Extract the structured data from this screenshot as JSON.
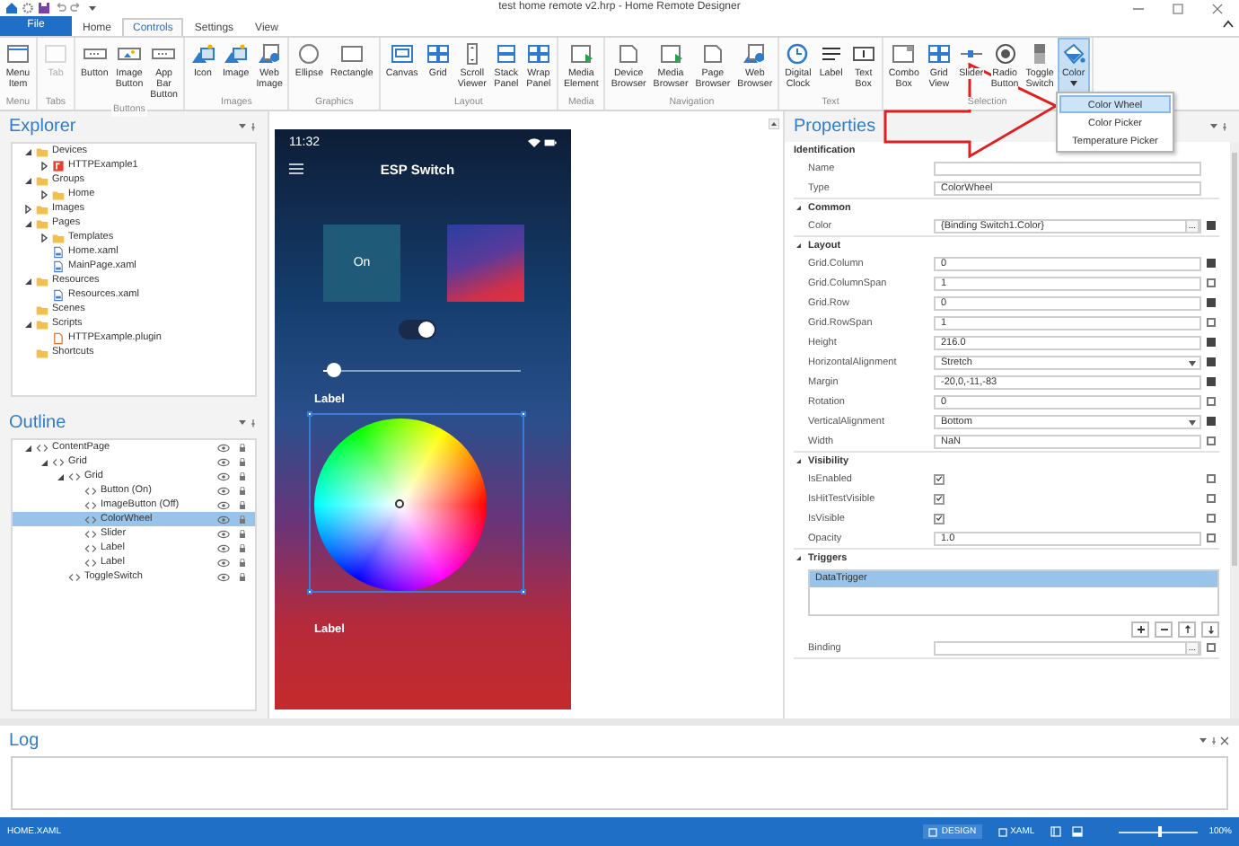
{
  "window": {
    "title": "test home remote v2.hrp - Home Remote Designer"
  },
  "menu_tabs": [
    {
      "label": "File",
      "kind": "file",
      "selected": false
    },
    {
      "label": "Home",
      "kind": "tab",
      "selected": false
    },
    {
      "label": "Controls",
      "kind": "tab",
      "selected": true
    },
    {
      "label": "Settings",
      "kind": "tab",
      "selected": false
    },
    {
      "label": "View",
      "kind": "tab",
      "selected": false
    }
  ],
  "ribbon": {
    "groups": [
      {
        "label": "Menu",
        "items": [
          {
            "label": "Menu Item",
            "kind": "window",
            "disabled": false,
            "selected": false
          }
        ]
      },
      {
        "label": "Tabs",
        "items": [
          {
            "label": "Tab",
            "kind": "tab",
            "disabled": true,
            "selected": false
          }
        ]
      },
      {
        "label": "Buttons",
        "items": [
          {
            "label": "Button",
            "kind": "button",
            "disabled": false,
            "selected": false
          },
          {
            "label": "Image Button",
            "kind": "image-button",
            "disabled": false,
            "selected": false
          },
          {
            "label": "App Bar Button",
            "kind": "button",
            "disabled": false,
            "selected": false
          }
        ]
      },
      {
        "label": "Images",
        "items": [
          {
            "label": "Icon",
            "kind": "image",
            "disabled": false,
            "selected": false
          },
          {
            "label": "Image",
            "kind": "image",
            "disabled": false,
            "selected": false
          },
          {
            "label": "Web Image",
            "kind": "web-image",
            "disabled": false,
            "selected": false
          }
        ]
      },
      {
        "label": "Graphics",
        "items": [
          {
            "label": "Ellipse",
            "kind": "ellipse",
            "disabled": false,
            "selected": false
          },
          {
            "label": "Rectangle",
            "kind": "rectangle",
            "disabled": false,
            "selected": false
          }
        ]
      },
      {
        "label": "Layout",
        "items": [
          {
            "label": "Canvas",
            "kind": "canvas",
            "disabled": false,
            "selected": false
          },
          {
            "label": "Grid",
            "kind": "grid",
            "disabled": false,
            "selected": false
          },
          {
            "label": "Scroll Viewer",
            "kind": "scroll",
            "disabled": false,
            "selected": false
          },
          {
            "label": "Stack Panel",
            "kind": "stack",
            "disabled": false,
            "selected": false
          },
          {
            "label": "Wrap Panel",
            "kind": "grid",
            "disabled": false,
            "selected": false
          }
        ]
      },
      {
        "label": "Media",
        "items": [
          {
            "label": "Media Element",
            "kind": "media",
            "disabled": false,
            "selected": false
          }
        ]
      },
      {
        "label": "Navigation",
        "items": [
          {
            "label": "Device Browser",
            "kind": "browser",
            "disabled": false,
            "selected": false
          },
          {
            "label": "Media Browser",
            "kind": "media",
            "disabled": false,
            "selected": false
          },
          {
            "label": "Page Browser",
            "kind": "browser",
            "disabled": false,
            "selected": false
          },
          {
            "label": "Web Browser",
            "kind": "web-image",
            "disabled": false,
            "selected": false
          }
        ]
      },
      {
        "label": "Text",
        "items": [
          {
            "label": "Digital Clock",
            "kind": "clock",
            "disabled": false,
            "selected": false
          },
          {
            "label": "Label",
            "kind": "label",
            "disabled": false,
            "selected": false
          },
          {
            "label": "Text Box",
            "kind": "textbox",
            "disabled": false,
            "selected": false
          }
        ]
      },
      {
        "label": "Selection",
        "items": [
          {
            "label": "Combo Box",
            "kind": "combo",
            "disabled": false,
            "selected": false
          },
          {
            "label": "Grid View",
            "kind": "grid",
            "disabled": false,
            "selected": false
          },
          {
            "label": "Slider",
            "kind": "slider",
            "disabled": false,
            "selected": false
          },
          {
            "label": "Radio Button",
            "kind": "radio",
            "disabled": false,
            "selected": false
          },
          {
            "label": "Toggle Switch",
            "kind": "toggle",
            "disabled": false,
            "selected": false
          },
          {
            "label": "Color",
            "kind": "color",
            "disabled": false,
            "selected": true,
            "menu": [
              {
                "label": "Color Wheel",
                "selected": true
              },
              {
                "label": "Color Picker",
                "selected": false
              },
              {
                "label": "Temperature Picker",
                "selected": false
              }
            ]
          }
        ]
      }
    ]
  },
  "explorer": {
    "title": "Explorer",
    "items": [
      {
        "label": "Devices",
        "kind": "folder",
        "expanded": true,
        "children": [
          {
            "label": "HTTPExample1",
            "kind": "device",
            "expanded": false
          }
        ]
      },
      {
        "label": "Groups",
        "kind": "folder",
        "expanded": true,
        "children": [
          {
            "label": "Home",
            "kind": "folder",
            "expanded": false
          }
        ]
      },
      {
        "label": "Images",
        "kind": "folder",
        "expanded": false
      },
      {
        "label": "Pages",
        "kind": "folder",
        "expanded": true,
        "children": [
          {
            "label": "Templates",
            "kind": "folder",
            "expanded": false
          },
          {
            "label": "Home.xaml",
            "kind": "file"
          },
          {
            "label": "MainPage.xaml",
            "kind": "file"
          }
        ]
      },
      {
        "label": "Resources",
        "kind": "folder",
        "expanded": true,
        "children": [
          {
            "label": "Resources.xaml",
            "kind": "file"
          }
        ]
      },
      {
        "label": "Scenes",
        "kind": "folder"
      },
      {
        "label": "Scripts",
        "kind": "folder",
        "expanded": true,
        "children": [
          {
            "label": "HTTPExample.plugin",
            "kind": "script"
          }
        ]
      },
      {
        "label": "Shortcuts",
        "kind": "folder"
      }
    ]
  },
  "outline": {
    "title": "Outline",
    "items": [
      {
        "label": "ContentPage",
        "selected": false,
        "expanded": true,
        "children": [
          {
            "label": "Grid",
            "selected": false,
            "expanded": true,
            "children": [
              {
                "label": "Grid",
                "selected": false,
                "expanded": true,
                "children": [
                  {
                    "label": "Button (On)",
                    "selected": false
                  },
                  {
                    "label": "ImageButton (Off)",
                    "selected": false
                  },
                  {
                    "label": "ColorWheel",
                    "selected": true
                  },
                  {
                    "label": "Slider",
                    "selected": false
                  },
                  {
                    "label": "Label",
                    "selected": false
                  },
                  {
                    "label": "Label",
                    "selected": false
                  }
                ]
              },
              {
                "label": "ToggleSwitch",
                "selected": false
              }
            ]
          }
        ]
      }
    ]
  },
  "preview": {
    "time": "11:32",
    "title": "ESP Switch",
    "button": "On",
    "toggle_on": true,
    "slider": {
      "level": 0.05
    },
    "labels": [
      "Label",
      "Label"
    ]
  },
  "properties": {
    "title": "Properties",
    "sections": [
      {
        "title": "Identification",
        "rows": [
          {
            "label": "Name",
            "kind": "text"
          },
          {
            "label": "Type",
            "kind": "text",
            "value": "ColorWheel"
          }
        ]
      },
      {
        "title": "Common",
        "expanded": true,
        "rows": [
          {
            "label": "Color",
            "kind": "binding",
            "value": "{Binding Switch1.Color}",
            "button": "...",
            "local_value": true
          }
        ]
      },
      {
        "title": "Layout",
        "expanded": true,
        "rows": [
          {
            "label": "Grid.Column",
            "kind": "text",
            "value": "0",
            "local_value": true
          },
          {
            "label": "Grid.ColumnSpan",
            "kind": "text",
            "value": "1",
            "local_value": false
          },
          {
            "label": "Grid.Row",
            "kind": "text",
            "value": "0",
            "local_value": true
          },
          {
            "label": "Grid.RowSpan",
            "kind": "text",
            "value": "1",
            "local_value": false
          },
          {
            "label": "Height",
            "kind": "text",
            "value": "216.0",
            "local_value": true
          },
          {
            "label": "HorizontalAlignment",
            "kind": "dropdown",
            "value": "Stretch",
            "local_value": true
          },
          {
            "label": "Margin",
            "kind": "text",
            "value": "-20,0,-11,-83",
            "local_value": true
          },
          {
            "label": "Rotation",
            "kind": "text",
            "value": "0",
            "local_value": false
          },
          {
            "label": "VerticalAlignment",
            "kind": "dropdown",
            "value": "Bottom",
            "local_value": true
          },
          {
            "label": "Width",
            "kind": "text",
            "value": "NaN",
            "local_value": false
          }
        ]
      },
      {
        "title": "Visibility",
        "expanded": true,
        "rows": [
          {
            "label": "IsEnabled",
            "kind": "checkbox",
            "checked": true,
            "local_value": false
          },
          {
            "label": "IsHitTestVisible",
            "kind": "checkbox",
            "checked": true,
            "local_value": false
          },
          {
            "label": "IsVisible",
            "kind": "checkbox",
            "checked": true,
            "local_value": false
          },
          {
            "label": "Opacity",
            "kind": "text",
            "value": "1.0",
            "local_value": false
          }
        ]
      },
      {
        "title": "Triggers",
        "expanded": true,
        "triggers": [
          {
            "label": "DataTrigger",
            "selected": true
          }
        ],
        "rows": [
          {
            "label": "Binding",
            "kind": "binding",
            "button": "...",
            "local_value": false
          }
        ]
      }
    ]
  },
  "log": {
    "title": "Log"
  },
  "status_bar": {
    "file": "HOME.XAML",
    "views": [
      {
        "label": "DESIGN",
        "selected": true
      },
      {
        "label": "XAML",
        "selected": false
      }
    ],
    "zoom_slider": {
      "level": 0.5
    },
    "zoom": "100%"
  }
}
